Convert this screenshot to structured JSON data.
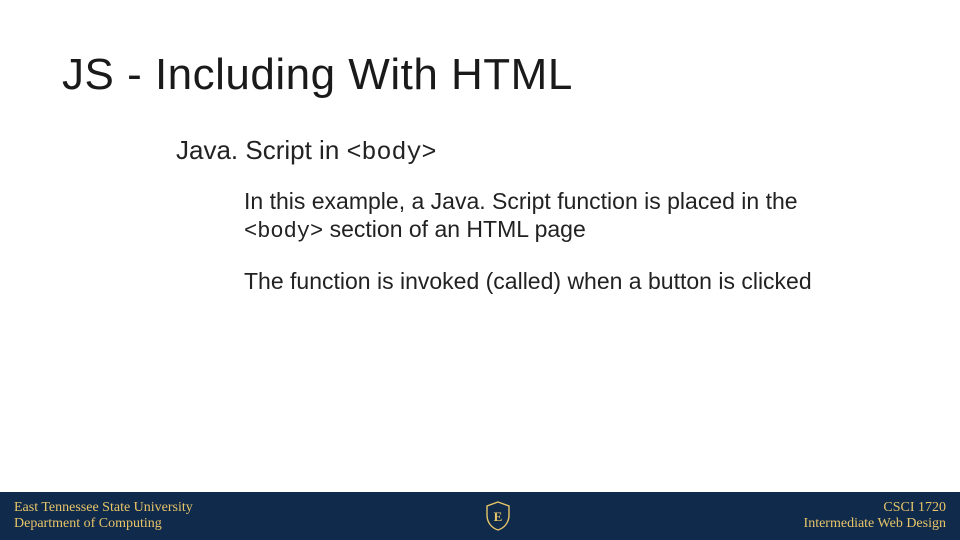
{
  "title": "JS - Including With HTML",
  "subtitle_prefix": "Java. Script in ",
  "subtitle_code": "<body>",
  "para1_a": "In this example, a Java. Script function is placed in the ",
  "para1_code": "<body>",
  "para1_b": " section of an HTML page",
  "para2": "The function is invoked (called) when a button is clicked",
  "footer": {
    "left_line1": "East Tennessee State University",
    "left_line2": "Department of Computing",
    "right_line1": "CSCI 1720",
    "right_line2": "Intermediate Web Design",
    "logo_letter": "E"
  }
}
